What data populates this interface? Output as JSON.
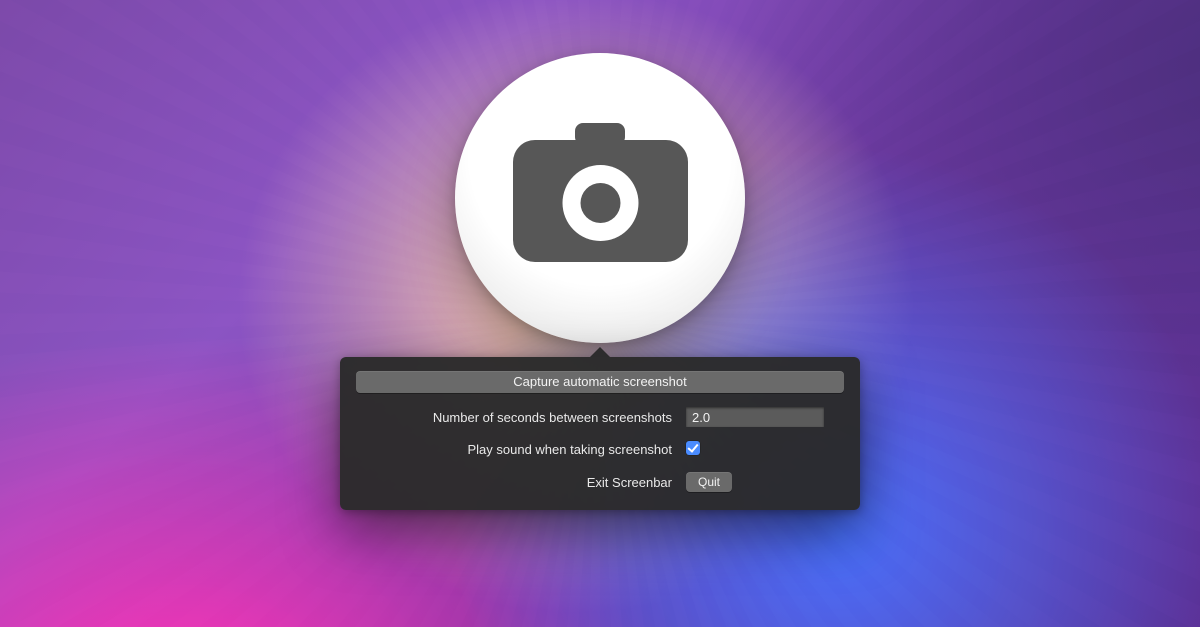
{
  "capture_button_label": "Capture automatic screenshot",
  "interval": {
    "label": "Number of seconds between screenshots",
    "value": "2.0"
  },
  "sound": {
    "label": "Play sound when taking screenshot",
    "checked": true
  },
  "exit": {
    "label": "Exit Screenbar",
    "button_label": "Quit"
  }
}
